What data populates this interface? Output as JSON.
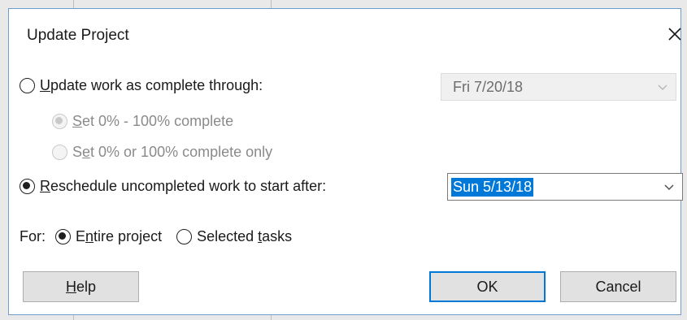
{
  "dialog": {
    "title": "Update Project"
  },
  "option_update": {
    "label_mnemonic": "U",
    "label_rest": "pdate work as complete through:",
    "date_value": "Fri 7/20/18",
    "checked": false
  },
  "sub_options": {
    "set_range": {
      "mnemonic": "S",
      "rest": "et 0% - 100% complete",
      "checked": true
    },
    "set_binary": {
      "before": "S",
      "mnemonic": "e",
      "rest": "t 0% or 100% complete only",
      "checked": false
    }
  },
  "option_reschedule": {
    "label_mnemonic": "R",
    "label_rest": "eschedule uncompleted work to start after:",
    "date_value": "Sun 5/13/18",
    "checked": true
  },
  "scope": {
    "label": "For:",
    "entire_project": {
      "before": "E",
      "mnemonic": "n",
      "rest": "tire project",
      "checked": true
    },
    "selected_tasks": {
      "before": "Selected ",
      "mnemonic": "t",
      "rest": "asks",
      "checked": false
    }
  },
  "buttons": {
    "help": {
      "mnemonic": "H",
      "rest": "elp"
    },
    "ok": "OK",
    "cancel": "Cancel"
  },
  "icons": {
    "close": "close-icon",
    "dropdown": "chevron-down-icon"
  },
  "colors": {
    "accent": "#0078d7",
    "border": "#6f9bd1"
  }
}
